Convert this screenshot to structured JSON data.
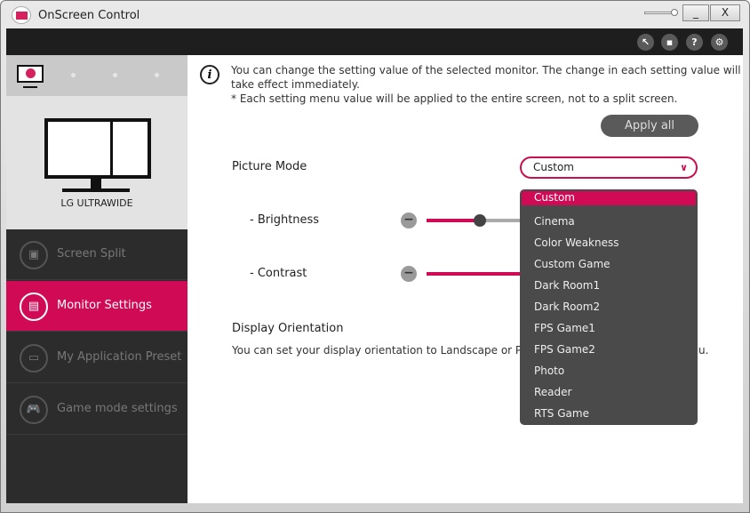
{
  "window": {
    "title": "OnScreen Control",
    "minimize": "_",
    "close": "X"
  },
  "toolbar": {
    "icons": [
      "cursor-icon",
      "screen-icon",
      "help-icon",
      "gear-icon"
    ],
    "help": "?",
    "gear": "⚙"
  },
  "monitor": {
    "name": "LG ULTRAWIDE"
  },
  "sidebar": {
    "items": [
      {
        "label": "Screen Split",
        "icon": "screen-split-icon",
        "glyph": "▣"
      },
      {
        "label": "Monitor Settings",
        "icon": "monitor-settings-icon",
        "glyph": "▤"
      },
      {
        "label": "My Application Preset",
        "icon": "app-preset-icon",
        "glyph": "▭"
      },
      {
        "label": "Game mode settings",
        "icon": "gamepad-icon",
        "glyph": "🎮"
      }
    ],
    "active": "Monitor Settings"
  },
  "main": {
    "info_line1": "You can change the setting value of the selected monitor. The change in each setting value will take effect immediately.",
    "info_line2": "* Each setting menu value will be applied to the entire screen, not to a split screen.",
    "apply_all": "Apply all",
    "picture_mode_label": "Picture Mode",
    "picture_mode_value": "Custom",
    "brightness_label": "- Brightness",
    "brightness_level_percent": 30,
    "contrast_label": "- Contrast",
    "display_orientation_label": "Display Orientation",
    "orientation_text_left": "You can set your display orientation to Landscape or Portr",
    "orientation_text_right": "u."
  },
  "dropdown": {
    "options": [
      "Custom",
      "Cinema",
      "Color Weakness",
      "Custom Game",
      "Dark Room1",
      "Dark Room2",
      "FPS Game1",
      "FPS Game2",
      "Photo",
      "Reader",
      "RTS Game"
    ],
    "selected": "Custom"
  },
  "colors": {
    "accent": "#d10a56",
    "sidebar": "#2c2c2c",
    "dropdown": "#4a4a4a"
  }
}
